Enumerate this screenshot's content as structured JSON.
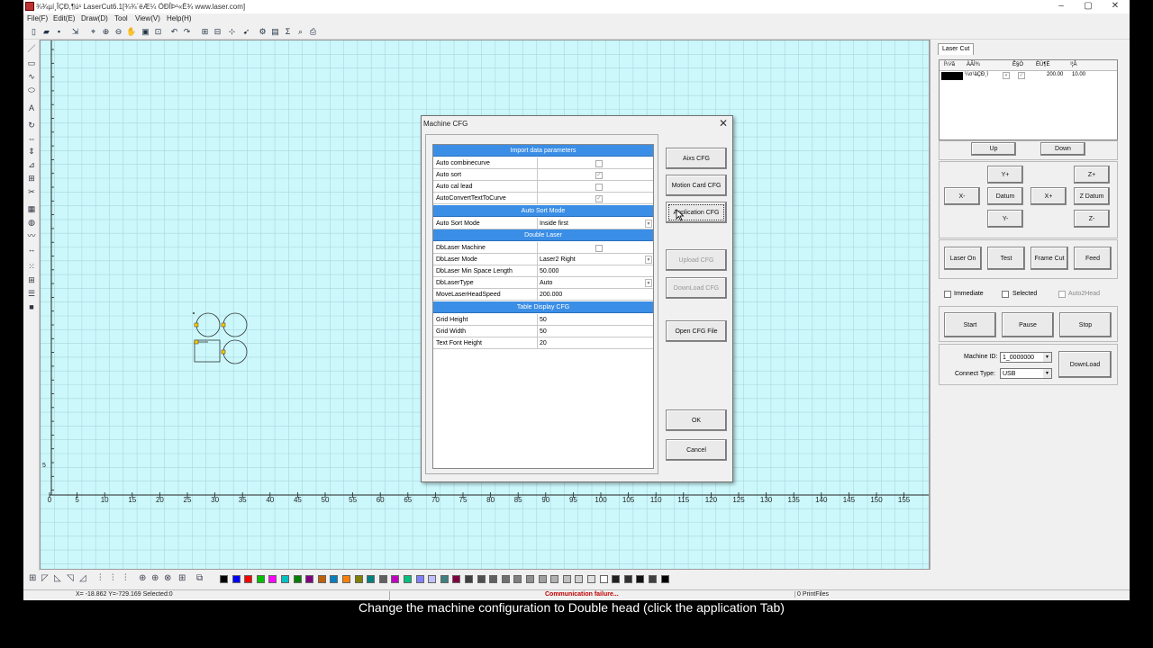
{
  "window": {
    "title": "¾­¾µí¸ÎÇÐ,¶ú¹ LaserCut6.1[¾­¾´ëÆ¼ ÖÐÎÞ¹«Ë¾ www.laser.com]",
    "controls": [
      "–",
      "▢",
      "✕"
    ]
  },
  "menu": [
    "File(F)",
    "Edit(E)",
    "Draw(D)",
    "Tool",
    "View(V)",
    "Help(H)"
  ],
  "canvas": {
    "x_ticks": [
      "0",
      "5",
      "10",
      "15",
      "20",
      "25",
      "30",
      "35",
      "40",
      "45",
      "50",
      "55",
      "60",
      "65",
      "70",
      "75",
      "80",
      "85",
      "90",
      "95",
      "100",
      "105",
      "110",
      "115",
      "120",
      "125",
      "130",
      "135",
      "140",
      "145",
      "150",
      "155"
    ],
    "y_tick": "5",
    "bg_color": "#ccf8fc",
    "grid_color": "#a9d6dc"
  },
  "palette": [
    "#000000",
    "#0000ff",
    "#ff0000",
    "#00c000",
    "#ff00ff",
    "#00c0c0",
    "#008000",
    "#800080",
    "#c06000",
    "#0080c0",
    "#ff8000",
    "#808000",
    "#008080",
    "#606060",
    "#c000c0",
    "#00c080",
    "#8080ff",
    "#c0c0ff",
    "#408080",
    "#800040",
    "#404040",
    "#505050",
    "#606060",
    "#707070",
    "#808080",
    "#909090",
    "#a0a0a0",
    "#b0b0b0",
    "#c0c0c0",
    "#d0d0d0",
    "#e0e0e0",
    "#ffffff",
    "#202020",
    "#303030",
    "#101010",
    "#404040",
    "#000000"
  ],
  "status": {
    "coords": "X= -18.862 Y=-729.169 Selected:0",
    "comm": "Communication failure...",
    "files": "0 PrintFiles"
  },
  "right_panel": {
    "tab": "Laser Cut",
    "layer_headers": [
      "Í¼²ã",
      "ÀÃÌ¾",
      "Ê§Ó",
      "ËÙ¶È",
      "¹¦Â"
    ],
    "layer_row": {
      "name": "¼¤¹âÇÐ¸î",
      "speed": "200.00",
      "power": "10.00"
    },
    "up": "Up",
    "down": "Down",
    "yplus": "Y+",
    "yminus": "Y-",
    "xminus": "X-",
    "xplus": "X+",
    "datum": "Datum",
    "zplus": "Z+",
    "zdatum": "Z Datum",
    "zminus": "Z-",
    "laser_on": "Laser On",
    "test": "Test",
    "frame_cut": "Frame Cut",
    "feed": "Feed",
    "immediate": "Immediate",
    "selected": "Selected",
    "auto2head": "Auto2Head",
    "start": "Start",
    "pause": "Pause",
    "stop": "Stop",
    "machine_id_label": "Machine ID:",
    "machine_id": "1_0000000",
    "connect_type_label": "Connect Type:",
    "connect_type": "USB",
    "download": "DownLoad"
  },
  "dialog": {
    "title": "Machine CFG",
    "sections": {
      "import": "Import data parameters",
      "autosort": "Auto Sort Mode",
      "double": "Double Laser",
      "table": "Table Display CFG"
    },
    "rows": {
      "auto_combine": "Auto combinecurve",
      "auto_sort": "Auto sort",
      "auto_lead": "Auto cal lead",
      "auto_convert": "AutoConvertTextToCurve",
      "auto_sort_mode": "Auto Sort Mode",
      "auto_sort_mode_val": "Inside first",
      "db_machine": "DbLaser Machine",
      "db_mode": "DbLaser Mode",
      "db_mode_val": "Laser2 Right",
      "db_min": "DbLaser Min Space Length",
      "db_min_val": "50.000",
      "db_type": "DbLaserType",
      "db_type_val": "Auto",
      "move_speed": "MoveLaserHeadSpeed",
      "move_speed_val": "200.000",
      "grid_height": "Grid Height",
      "grid_height_val": "50",
      "grid_width": "Grid Width",
      "grid_width_val": "50",
      "font_height": "Text Font Height",
      "font_height_val": "20"
    },
    "buttons": {
      "axis": "Aixs CFG",
      "motion": "Motion Card CFG",
      "application": "Application CFG",
      "upload": "Upload CFG",
      "download": "DownLoad CFG",
      "open": "Open CFG File",
      "ok": "OK",
      "cancel": "Cancel"
    }
  },
  "caption": "Change the machine configuration to Double head (click the application Tab)"
}
